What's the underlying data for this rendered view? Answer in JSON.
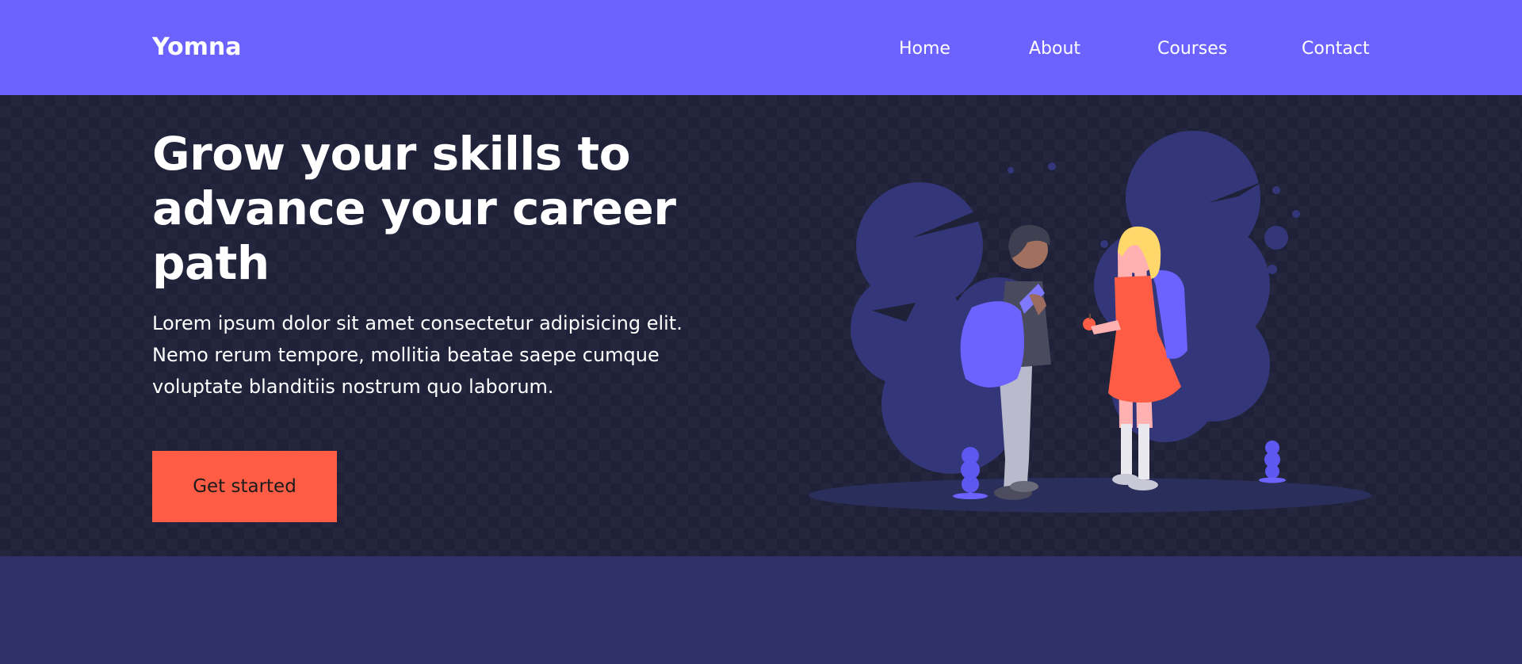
{
  "brand": {
    "name": "Yomna"
  },
  "nav": {
    "items": [
      {
        "label": "Home"
      },
      {
        "label": "About"
      },
      {
        "label": "Courses"
      },
      {
        "label": "Contact"
      }
    ]
  },
  "hero": {
    "title": "Grow your skills to advance your career path",
    "description": "Lorem ipsum dolor sit amet consectetur adipisicing elit. Nemo rerum tempore, mollitia beatae saepe cumque voluptate blanditiis nostrum quo laborum.",
    "cta_label": "Get started"
  },
  "colors": {
    "primary": "#6c63ff",
    "accent": "#ff5c45",
    "hero_background": "#1e2137",
    "footer_background": "#2f3066"
  },
  "illustration": {
    "subject": "two students with backpacks",
    "icons": [
      "student-boy-icon",
      "student-girl-icon",
      "apple-icon",
      "tree-icon"
    ]
  }
}
